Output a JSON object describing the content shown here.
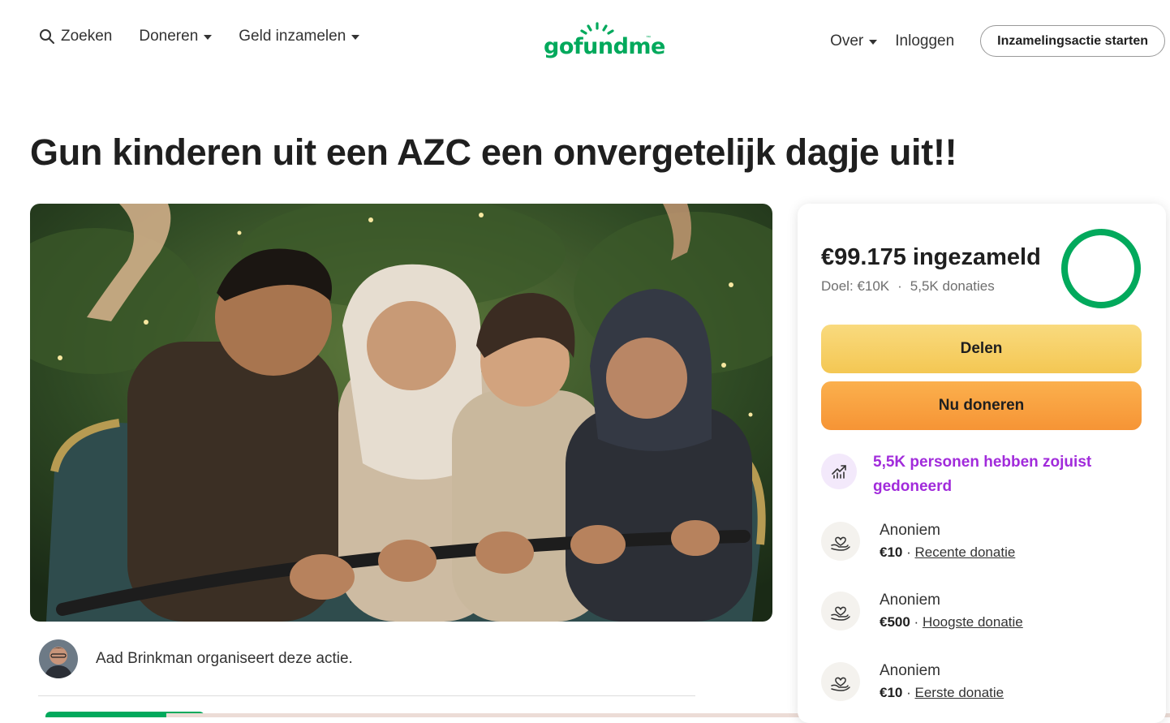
{
  "nav": {
    "search_label": "Zoeken",
    "donate_label": "Doneren",
    "fundraise_label": "Geld inzamelen",
    "logo_text": "gofundme",
    "about_label": "Over",
    "login_label": "Inloggen",
    "start_label": "Inzamelingsactie starten"
  },
  "campaign": {
    "title": "Gun kinderen uit een AZC een onvergetelijk dagje uit!!",
    "organizer_text": "Aad Brinkman organiseert deze actie."
  },
  "stats": {
    "raised": "€99.175 ingezameld",
    "goal": "Doel: €10K",
    "separator": "·",
    "donations": "5,5K donaties",
    "progress_fraction": 0.99
  },
  "actions": {
    "share_label": "Delen",
    "donate_label": "Nu doneren"
  },
  "trend_text": "5,5K personen hebben zojuist gedoneerd",
  "donations": [
    {
      "name": "Anoniem",
      "amount": "€10",
      "sep": " · ",
      "tag": "Recente donatie"
    },
    {
      "name": "Anoniem",
      "amount": "€500",
      "sep": " · ",
      "tag": "Hoogste donatie"
    },
    {
      "name": "Anoniem",
      "amount": "€10",
      "sep": " · ",
      "tag": "Eerste donatie"
    }
  ],
  "colors": {
    "brand_green": "#02a95c",
    "share_yellow": "#f4c753",
    "donate_orange": "#f69435",
    "trend_purple": "#a12bdb"
  }
}
